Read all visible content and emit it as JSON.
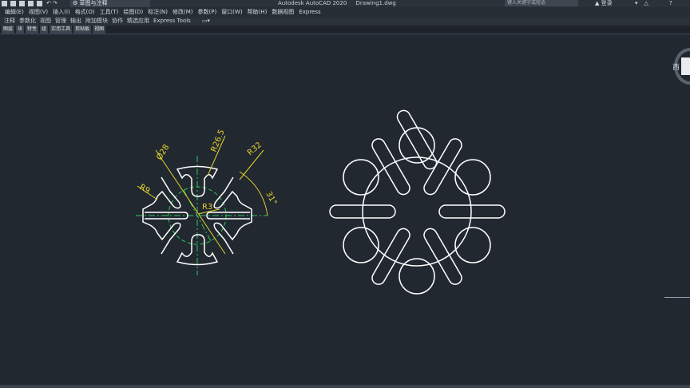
{
  "titlebar": {
    "workspace": "草图与注释",
    "app_title": "Autodesk AutoCAD 2020",
    "file_name": "Drawing1.dwg",
    "search_placeholder": "键入关键字或短语",
    "login_label": "登录",
    "help_label": "?"
  },
  "menubar": {
    "items": [
      "编辑(E)",
      "视图(V)",
      "插入(I)",
      "格式(O)",
      "工具(T)",
      "绘图(D)",
      "标注(N)",
      "修改(M)",
      "参数(P)",
      "窗口(W)",
      "帮助(H)",
      "数据视图",
      "Express"
    ]
  },
  "ribbon": {
    "tabs": [
      "注释",
      "参数化",
      "视图",
      "管理",
      "输出",
      "附加模块",
      "协作",
      "精选应用",
      "Express Tools"
    ]
  },
  "panels": {
    "chips": [
      "图层",
      "块",
      "特性",
      "组",
      "实用工具",
      "剪贴板",
      "视图"
    ]
  },
  "viewcube": {
    "direction_label": "西"
  },
  "drawing": {
    "dimensions": {
      "dia": "Ø28",
      "r26": "R26.5",
      "r32": "R32",
      "r9": "R9",
      "r3": "R3",
      "angle": "31°"
    },
    "colors": {
      "geometry": "#ffffff",
      "centerline": "#2ec85a",
      "dimension": "#e6d22e"
    }
  }
}
